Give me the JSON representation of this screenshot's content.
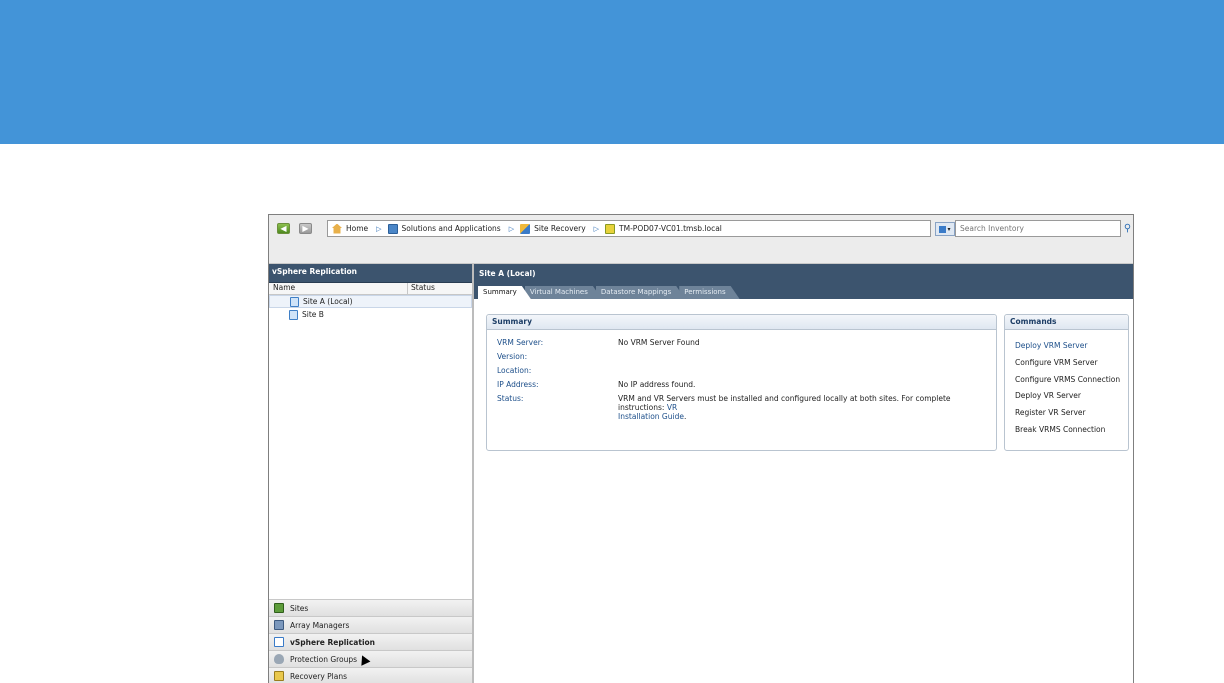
{
  "breadcrumb": [
    "Home",
    "Solutions and Applications",
    "Site Recovery",
    "TM-POD07-VC01.tmsb.local"
  ],
  "search": {
    "placeholder": "Search Inventory"
  },
  "left_panel": {
    "title": "vSphere Replication",
    "columns": [
      "Name",
      "Status"
    ],
    "sites": [
      "Site A (Local)",
      "Site B"
    ]
  },
  "nav": {
    "items": [
      "Sites",
      "Array Managers",
      "vSphere Replication",
      "Protection Groups",
      "Recovery Plans"
    ]
  },
  "right_panel": {
    "title": "Site A (Local)",
    "tabs": [
      "Summary",
      "Virtual Machines",
      "Datastore Mappings",
      "Permissions"
    ]
  },
  "summary": {
    "title": "Summary",
    "fields": [
      {
        "label": "VRM Server:",
        "value": "No VRM Server Found"
      },
      {
        "label": "Version:",
        "value": ""
      },
      {
        "label": "Location:",
        "value": ""
      },
      {
        "label": "IP Address:",
        "value": "No IP address found."
      },
      {
        "label": "Status:",
        "value": "VRM and VR Servers must be installed and configured locally at both sites. For complete instructions: "
      }
    ],
    "status_link_line1": "VR",
    "status_link_line2": "Installation Guide",
    "status_link_tail": "."
  },
  "commands": {
    "title": "Commands",
    "items": [
      "Deploy VRM Server",
      "Configure VRM Server",
      "Configure VRMS Connection",
      "Deploy VR Server",
      "Register VR Server",
      "Break VRMS Connection"
    ]
  },
  "colors": {
    "banner": "#4394d8",
    "panel_header": "#3c546e",
    "link": "#1d4f8a"
  },
  "icons": [
    "back-arrow-icon",
    "forward-arrow-icon",
    "home-icon",
    "solutions-icon",
    "site-recovery-icon",
    "vcenter-icon",
    "search-scope-icon",
    "magnifier-icon",
    "site-icon",
    "sites-nav-icon",
    "array-managers-icon",
    "vsphere-replication-icon",
    "protection-groups-icon",
    "recovery-plans-icon",
    "mouse-cursor-icon"
  ]
}
